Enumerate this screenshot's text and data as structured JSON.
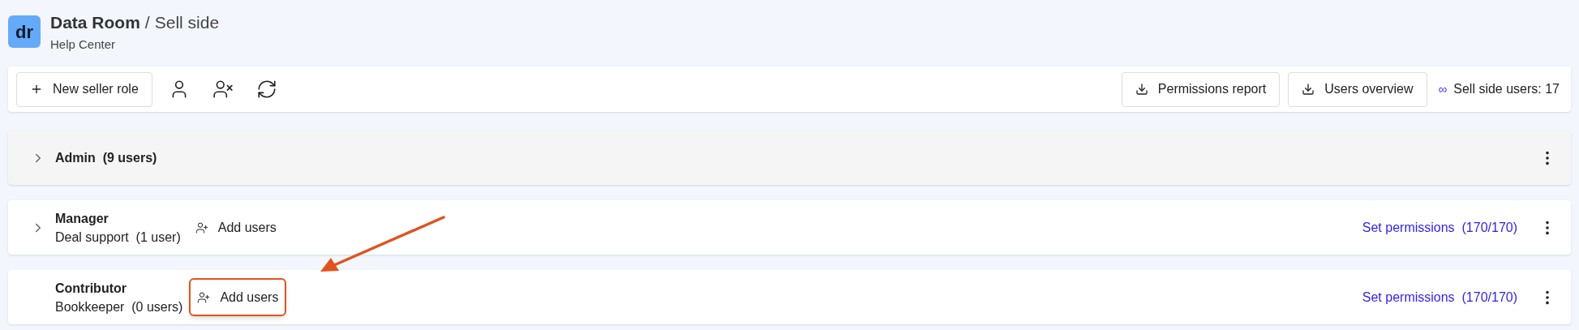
{
  "header": {
    "logo": "dr",
    "title": "Data Room",
    "separator": "/",
    "section": "Sell side",
    "subtitle": "Help Center"
  },
  "toolbar": {
    "new_role": "New seller role",
    "report_buttons": [
      "Permissions report",
      "Users overview"
    ],
    "users_count": {
      "symbol": "∞",
      "label": "Sell side users: 17"
    }
  },
  "roles": [
    {
      "name": "Admin",
      "count": "(9 users)",
      "expandable": true,
      "highlighted": true
    },
    {
      "name": "Manager",
      "subtitle": "Deal support",
      "count": "(1 user)",
      "expandable": true,
      "highlighted": false,
      "add_users": {
        "label": "Add users",
        "annotated": false
      },
      "permissions": "Set permissions  (170/170)"
    },
    {
      "name": "Contributor",
      "subtitle": "Bookkeeper",
      "count": "(0 users)",
      "expandable": false,
      "highlighted": false,
      "add_users": {
        "label": "Add users",
        "annotated": true
      },
      "permissions": "Set permissions  (170/170)"
    }
  ]
}
